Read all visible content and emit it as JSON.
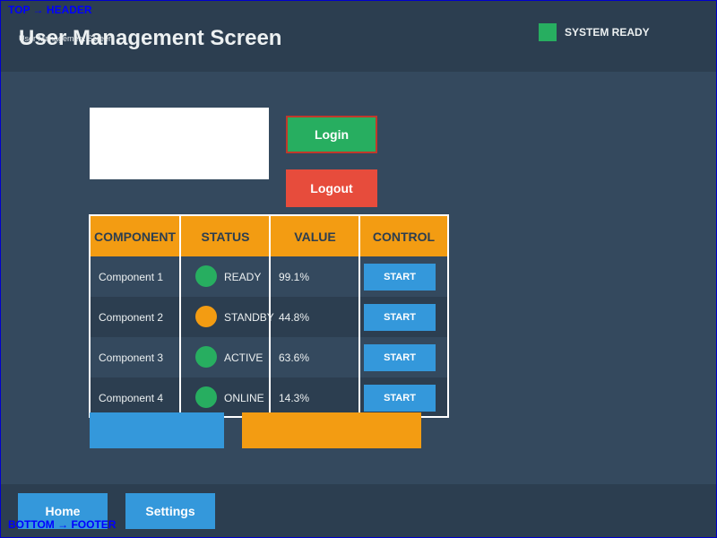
{
  "annotations": {
    "top": "TOP → HEADER",
    "bottom": "BOTTOM → FOOTER"
  },
  "header": {
    "title": "User Management Screen",
    "subtitle": "User Management Screen",
    "status": "SYSTEM READY",
    "status_color": "#27ae60"
  },
  "auth": {
    "login_label": "Login",
    "logout_label": "Logout",
    "user_field_value": ""
  },
  "table": {
    "headers": [
      "COMPONENT",
      "STATUS",
      "VALUE",
      "CONTROL"
    ],
    "rows": [
      {
        "component": "Component 1",
        "status": "READY",
        "status_color": "#27ae60",
        "value": "99.1%",
        "control": "START"
      },
      {
        "component": "Component 2",
        "status": "STANDBY",
        "status_color": "#f39c12",
        "value": "44.8%",
        "control": "START"
      },
      {
        "component": "Component 3",
        "status": "ACTIVE",
        "status_color": "#27ae60",
        "value": "63.6%",
        "control": "START"
      },
      {
        "component": "Component 4",
        "status": "ONLINE",
        "status_color": "#27ae60",
        "value": "14.3%",
        "control": "START"
      }
    ]
  },
  "colors": {
    "background": "#34495e",
    "header": "#2c3e50",
    "accent_blue": "#3498db",
    "accent_orange": "#f39c12",
    "success": "#27ae60",
    "danger": "#e74c3c",
    "row_odd": "#34495e",
    "row_even": "#2c3e50"
  },
  "footer": {
    "home_label": "Home",
    "settings_label": "Settings"
  }
}
